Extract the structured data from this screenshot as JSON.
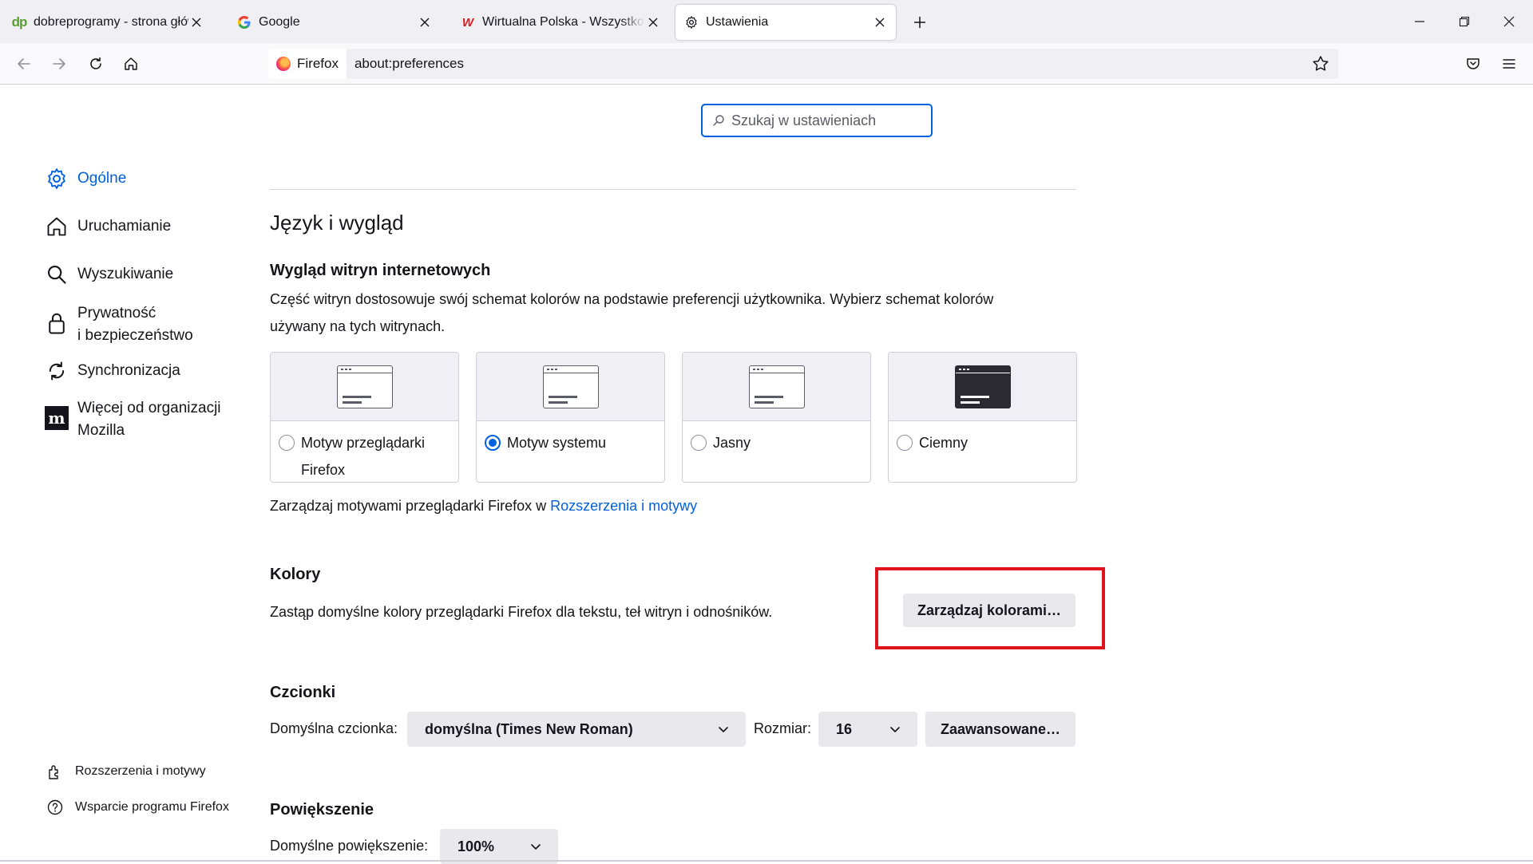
{
  "tabs": [
    {
      "title": "dobreprogramy - strona główna",
      "favicon": "dobreprogramy-icon"
    },
    {
      "title": "Google",
      "favicon": "google-icon"
    },
    {
      "title": "Wirtualna Polska - Wszystko co",
      "favicon": "wp-icon"
    },
    {
      "title": "Ustawienia",
      "favicon": "gear-icon",
      "active": true
    }
  ],
  "navbar": {
    "identity_label": "Firefox",
    "url": "about:preferences"
  },
  "search": {
    "placeholder": "Szukaj w ustawieniach"
  },
  "sidebar": {
    "categories": [
      {
        "label": "Ogólne",
        "icon": "gear-icon",
        "selected": true
      },
      {
        "label": "Uruchamianie",
        "icon": "home-icon"
      },
      {
        "label": "Wyszukiwanie",
        "icon": "search-icon"
      },
      {
        "label_line1": "Prywatność",
        "label_line2": "i bezpieczeństwo",
        "icon": "lock-icon"
      },
      {
        "label": "Synchronizacja",
        "icon": "sync-icon"
      },
      {
        "label_line1": "Więcej od organizacji",
        "label_line2": "Mozilla",
        "icon": "mozilla-icon"
      }
    ],
    "footer": [
      {
        "label": "Rozszerzenia i motywy",
        "icon": "puzzle-icon"
      },
      {
        "label": "Wsparcie programu Firefox",
        "icon": "help-icon"
      }
    ]
  },
  "main": {
    "section_title": "Język i wygląd",
    "appearance": {
      "heading": "Wygląd witryn internetowych",
      "description_line1": "Część witryn dostosowuje swój schemat kolorów na podstawie preferencji użytkownika. Wybierz schemat kolorów",
      "description_line2": "używany na tych witrynach.",
      "options": [
        {
          "label_line1": "Motyw przeglądarki",
          "label_line2": "Firefox",
          "selected": false
        },
        {
          "label_line1": "Motyw systemu",
          "label_line2": "",
          "selected": true
        },
        {
          "label_line1": "Jasny",
          "label_line2": "",
          "selected": false
        },
        {
          "label_line1": "Ciemny",
          "label_line2": "",
          "selected": false
        }
      ],
      "manage_text": "Zarządzaj motywami przeglądarki Firefox w ",
      "manage_link": "Rozszerzenia i motywy"
    },
    "colors": {
      "heading": "Kolory",
      "description": "Zastąp domyślne kolory przeglądarki Firefox dla tekstu, teł witryn i odnośników.",
      "button": "Zarządzaj kolorami…"
    },
    "fonts": {
      "heading": "Czcionki",
      "default_font_label": "Domyślna czcionka:",
      "default_font_value": "domyślna (Times New Roman)",
      "size_label": "Rozmiar:",
      "size_value": "16",
      "advanced_button": "Zaawansowane…"
    },
    "zoom": {
      "heading": "Powiększenie",
      "default_zoom_label": "Domyślne powiększenie:",
      "default_zoom_value": "100%"
    }
  },
  "colors_palette": {
    "accent": "#0061e0",
    "highlight_box": "#e0141b"
  }
}
